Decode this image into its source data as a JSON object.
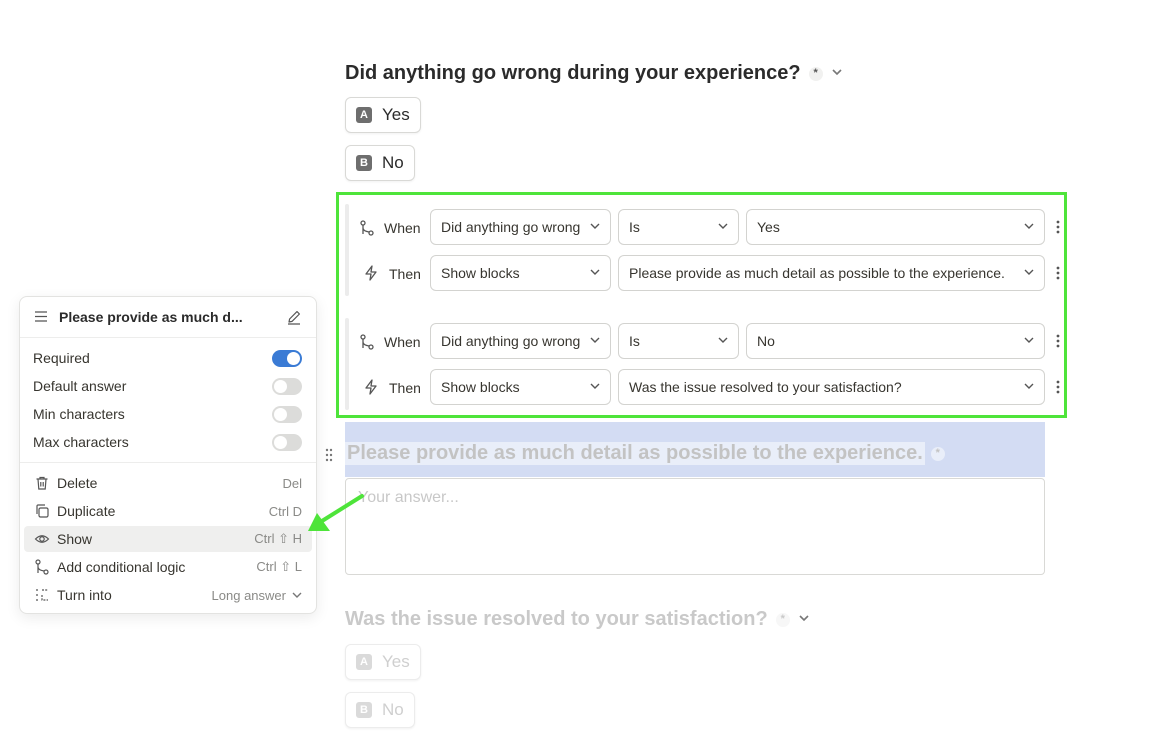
{
  "questions": {
    "q1": {
      "title": "Did anything go wrong during your experience?",
      "required_mark": "*",
      "choices": [
        {
          "key": "A",
          "label": "Yes"
        },
        {
          "key": "B",
          "label": "No"
        }
      ]
    },
    "q2": {
      "title": "Please provide as much detail as possible to the experience.",
      "required_mark": "*",
      "placeholder": "Your answer..."
    },
    "q3": {
      "title": "Was the issue resolved to your satisfaction?",
      "required_mark": "*",
      "choices": [
        {
          "key": "A",
          "label": "Yes"
        },
        {
          "key": "B",
          "label": "No"
        }
      ]
    }
  },
  "logic": {
    "rules": [
      {
        "when_label": "When",
        "when_question": "Did anything go wrong during your experience?",
        "operator": "Is",
        "value": "Yes",
        "then_label": "Then",
        "action": "Show blocks",
        "target": "Please provide as much detail as possible to the experience."
      },
      {
        "when_label": "When",
        "when_question": "Did anything go wrong during your experience?",
        "operator": "Is",
        "value": "No",
        "then_label": "Then",
        "action": "Show blocks",
        "target": "Was the issue resolved to your satisfaction?"
      }
    ]
  },
  "menu": {
    "title": "Please provide as much d...",
    "settings": [
      {
        "label": "Required",
        "on": true
      },
      {
        "label": "Default answer",
        "on": false
      },
      {
        "label": "Min characters",
        "on": false
      },
      {
        "label": "Max characters",
        "on": false
      }
    ],
    "actions": [
      {
        "label": "Delete",
        "shortcut": "Del"
      },
      {
        "label": "Duplicate",
        "shortcut": "Ctrl D"
      },
      {
        "label": "Show",
        "shortcut": "Ctrl ⇧ H"
      },
      {
        "label": "Add conditional logic",
        "shortcut": "Ctrl ⇧ L"
      },
      {
        "label": "Turn into",
        "shortcut": "Long answer"
      }
    ]
  },
  "colors": {
    "highlight_frame": "#4ee43a",
    "arrow": "#4ee43a",
    "toggle_on": "#3a7bd5",
    "selected_block_bg": "#d3dcf3"
  }
}
